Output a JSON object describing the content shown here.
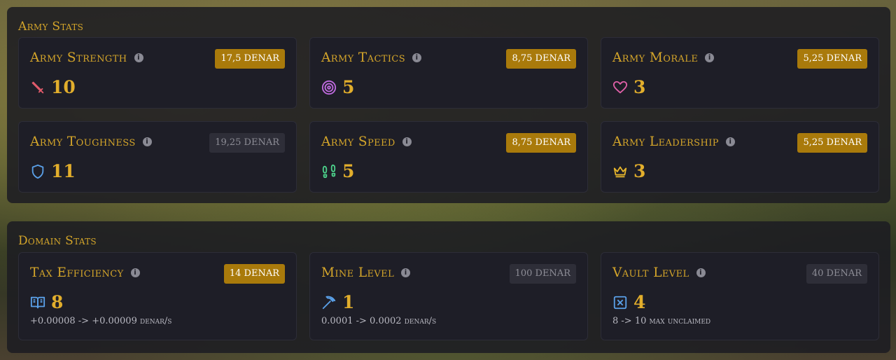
{
  "army": {
    "title": "Army Stats",
    "cards": [
      {
        "label": "Army Strength",
        "cost": "17,5 DENAR",
        "value": "10",
        "icon": "sword-icon",
        "color": "#e05a6a",
        "affordable": true
      },
      {
        "label": "Army Tactics",
        "cost": "8,75 DENAR",
        "value": "5",
        "icon": "target-icon",
        "color": "#c06be0",
        "affordable": true
      },
      {
        "label": "Army Morale",
        "cost": "5,25 DENAR",
        "value": "3",
        "icon": "heart-icon",
        "color": "#e060a8",
        "affordable": true
      },
      {
        "label": "Army Toughness",
        "cost": "19,25 DENAR",
        "value": "11",
        "icon": "shield-icon",
        "color": "#5aa0e8",
        "affordable": false
      },
      {
        "label": "Army Speed",
        "cost": "8,75 DENAR",
        "value": "5",
        "icon": "footprints-icon",
        "color": "#4cd08a",
        "affordable": true
      },
      {
        "label": "Army Leadership",
        "cost": "5,25 DENAR",
        "value": "3",
        "icon": "crown-icon",
        "color": "#e6b52c",
        "affordable": true
      }
    ]
  },
  "domain": {
    "title": "Domain Stats",
    "cards": [
      {
        "label": "Tax Efficiency",
        "cost": "14 DENAR",
        "value": "8",
        "detail": "+0.00008 -> +0.00009 denar/s",
        "icon": "book-icon",
        "color": "#5aa0e8",
        "affordable": true
      },
      {
        "label": "Mine Level",
        "cost": "100 DENAR",
        "value": "1",
        "detail": "0.0001 -> 0.0002 denar/s",
        "icon": "pickaxe-icon",
        "color": "#5aa0e8",
        "affordable": false
      },
      {
        "label": "Vault Level",
        "cost": "40 DENAR",
        "value": "4",
        "detail": "8 -> 10 max unclaimed",
        "icon": "vault-icon",
        "color": "#5aa0e8",
        "affordable": false
      }
    ]
  }
}
